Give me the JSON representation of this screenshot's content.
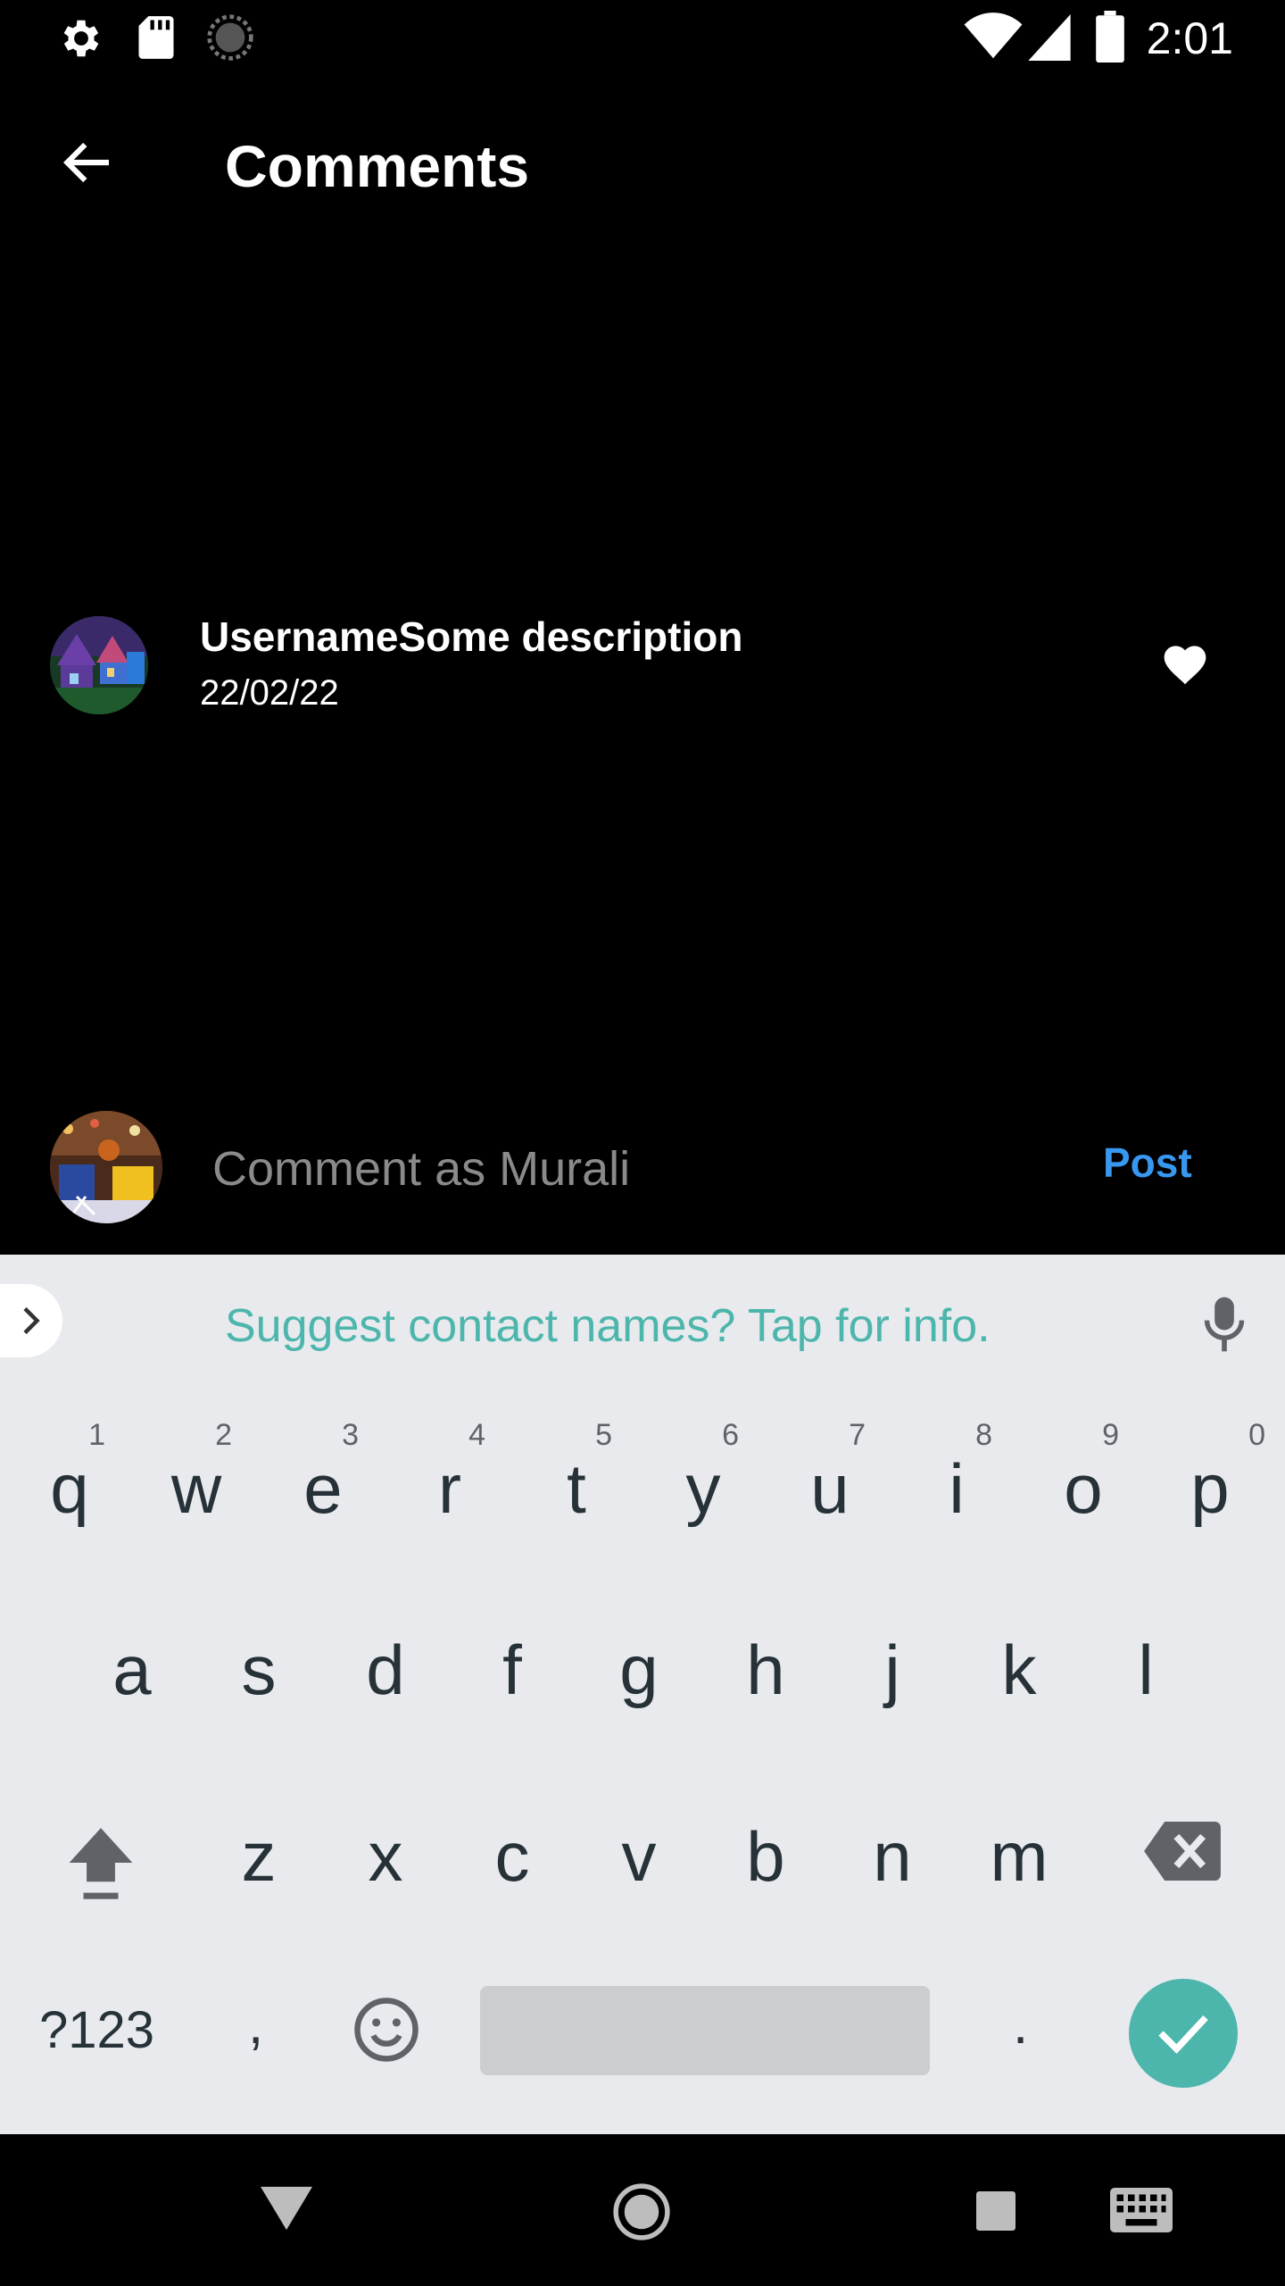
{
  "status_bar": {
    "time": "2:01",
    "icons": [
      "settings-icon",
      "sd-card-icon",
      "loading-icon",
      "wifi-icon",
      "signal-icon",
      "battery-icon"
    ]
  },
  "app_bar": {
    "title": "Comments",
    "back_icon": "arrow-back-icon"
  },
  "comment": {
    "username_text": "UsernameSome description",
    "date": "22/02/22",
    "like_icon": "heart-icon"
  },
  "input": {
    "placeholder": "Comment as Murali",
    "post_label": "Post"
  },
  "keyboard": {
    "suggestion": "Suggest contact names? Tap for info.",
    "row1": [
      "q",
      "w",
      "e",
      "r",
      "t",
      "y",
      "u",
      "i",
      "o",
      "p"
    ],
    "row1_hints": [
      "1",
      "2",
      "3",
      "4",
      "5",
      "6",
      "7",
      "8",
      "9",
      "0"
    ],
    "row2": [
      "a",
      "s",
      "d",
      "f",
      "g",
      "h",
      "j",
      "k",
      "l"
    ],
    "row3": [
      "z",
      "x",
      "c",
      "v",
      "b",
      "n",
      "m"
    ],
    "symbols_label": "?123",
    "comma": ",",
    "period": ".",
    "accent_color": "#4db6ac"
  },
  "nav_bar": {
    "icons": [
      "back-triangle-icon",
      "home-circle-icon",
      "recents-square-icon",
      "keyboard-icon"
    ]
  },
  "colors": {
    "background": "#000000",
    "post_link": "#3897f0",
    "keyboard_bg": "#e8eaed"
  }
}
